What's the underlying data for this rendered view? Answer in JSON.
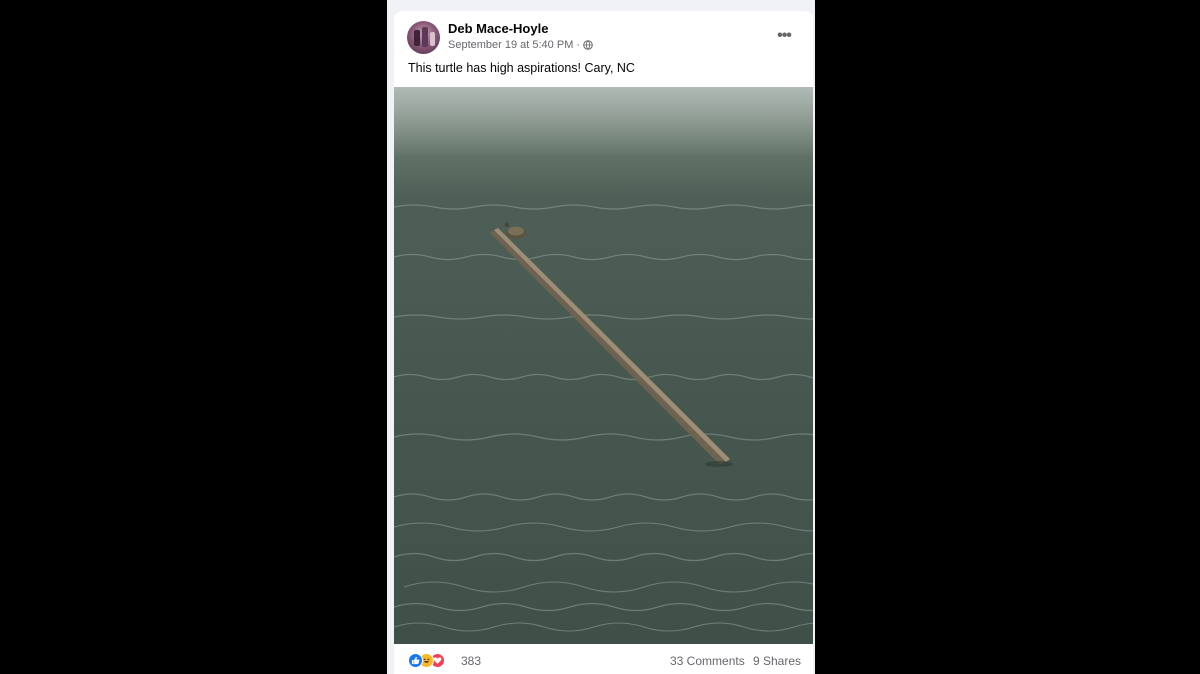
{
  "post": {
    "author": "Deb Mace-Hoyle",
    "timestamp": "September 19 at 5:40 PM",
    "separator": "·",
    "privacy_icon": "globe-icon",
    "more_options": "•••",
    "text": "This turtle has high aspirations! Cary, NC"
  },
  "engagement": {
    "reaction_icons": [
      "like-icon",
      "haha-icon",
      "love-icon"
    ],
    "reaction_count": "383",
    "comments": "33 Comments",
    "shares": "9 Shares"
  },
  "colors": {
    "page_background": "#000000",
    "feed_background": "#f0f2f5",
    "card_background": "#ffffff",
    "primary_text": "#050505",
    "secondary_text": "#65676b",
    "like_blue": "#1877f2",
    "love_red": "#f33e58",
    "haha_yellow": "#f7b928"
  }
}
